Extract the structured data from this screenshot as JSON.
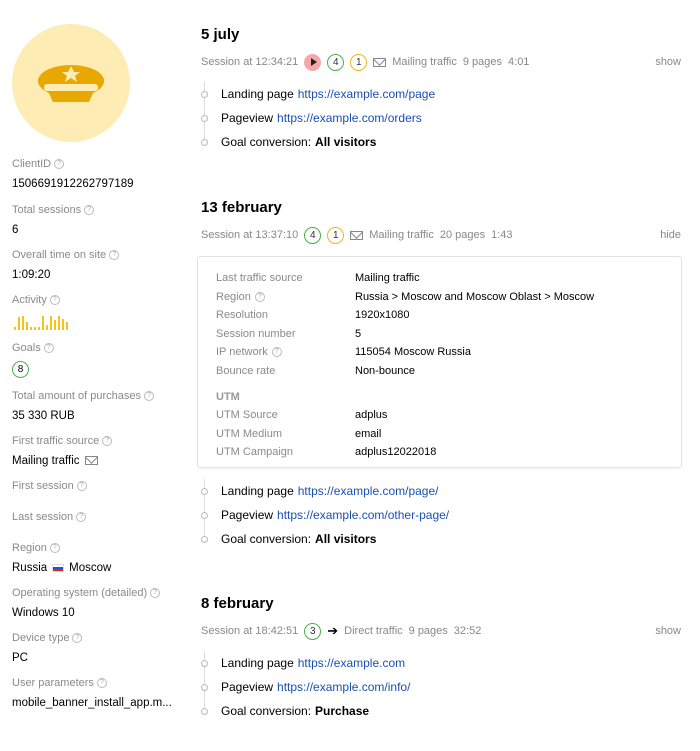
{
  "sidebar": {
    "client_id": {
      "label": "ClientID",
      "value": "1506691912262797189"
    },
    "total_sessions": {
      "label": "Total sessions",
      "value": "6"
    },
    "overall_time": {
      "label": "Overall time on site",
      "value": "1:09:20"
    },
    "activity": {
      "label": "Activity",
      "bars": [
        0.2,
        0.8,
        0.9,
        0.5,
        0.2,
        0.2,
        0.2,
        0.9,
        0.3,
        0.9,
        0.6,
        0.9,
        0.7,
        0.5
      ]
    },
    "goals": {
      "label": "Goals",
      "value": "8"
    },
    "purchases": {
      "label": "Total amount of purchases",
      "value": "35 330 RUB"
    },
    "first_traffic_source": {
      "label": "First traffic source",
      "value": "Mailing traffic"
    },
    "first_session": {
      "label": "First session"
    },
    "last_session": {
      "label": "Last session"
    },
    "region": {
      "label": "Region",
      "country": "Russia",
      "city": "Moscow"
    },
    "os": {
      "label": "Operating system (detailed)",
      "value": "Windows 10"
    },
    "device_type": {
      "label": "Device type",
      "value": "PC"
    },
    "user_params": {
      "label": "User parameters",
      "value": "mobile_banner_install_app.m..."
    }
  },
  "sessions": [
    {
      "date": "5 july",
      "time": "Session at 12:34:21",
      "badges": [
        "4",
        "1"
      ],
      "source": "Mailing traffic",
      "pages": "9 pages",
      "duration": "4:01",
      "toggle": "show",
      "events": [
        {
          "label": "Landing page",
          "link": "https://example.com/page"
        },
        {
          "label": "Pageview",
          "link": "https://example.com/orders"
        },
        {
          "label": "Goal conversion:",
          "strong": "All visitors"
        }
      ]
    },
    {
      "date": "13 february",
      "time": "Session at 13:37:10",
      "badges": [
        "4",
        "1"
      ],
      "source": "Mailing traffic",
      "pages": "20 pages",
      "duration": "1:43",
      "toggle": "hide",
      "details": [
        {
          "key": "Last traffic source",
          "value": "Mailing traffic"
        },
        {
          "key": "Region",
          "value": "Russia > Moscow and Moscow Oblast > Moscow"
        },
        {
          "key": "Resolution",
          "value": "1920x1080"
        },
        {
          "key": "Session number",
          "value": "5"
        },
        {
          "key": "IP network",
          "value": "115054 Moscow Russia"
        },
        {
          "key": "Bounce rate",
          "value": "Non-bounce"
        }
      ],
      "utm_title": "UTM",
      "utm": [
        {
          "key": "UTM Source",
          "value": "adplus"
        },
        {
          "key": "UTM Medium",
          "value": "email"
        },
        {
          "key": "UTM Campaign",
          "value": "adplus12022018"
        }
      ],
      "events": [
        {
          "label": "Landing page",
          "link": "https://example.com/page/"
        },
        {
          "label": "Pageview",
          "link": "https://example.com/other-page/"
        },
        {
          "label": "Goal conversion:",
          "strong": "All visitors"
        }
      ]
    },
    {
      "date": "8 february",
      "time": "Session at 18:42:51",
      "badges": [
        "3"
      ],
      "source": "Direct traffic",
      "pages": "9 pages",
      "duration": "32:52",
      "toggle": "show",
      "events": [
        {
          "label": "Landing page",
          "link": "https://example.com"
        },
        {
          "label": "Pageview",
          "link": "https://example.com/info/"
        },
        {
          "label": "Goal conversion:",
          "strong": "Purchase"
        }
      ]
    }
  ],
  "colors": {
    "accent_link": "#1a4fb5",
    "avatar_bg": "#fdecb3",
    "avatar_icon": "#e8a800",
    "goal_green": "#4caf50",
    "badge_yellow": "#f5b800",
    "activity_bar": "#f7c31b"
  },
  "icons": {
    "avatar": "cap-icon",
    "record": "play-icon",
    "mailing": "mail-icon",
    "direct": "arrow-right-icon",
    "help": "question-icon",
    "region_flag": "russia-flag-icon"
  }
}
